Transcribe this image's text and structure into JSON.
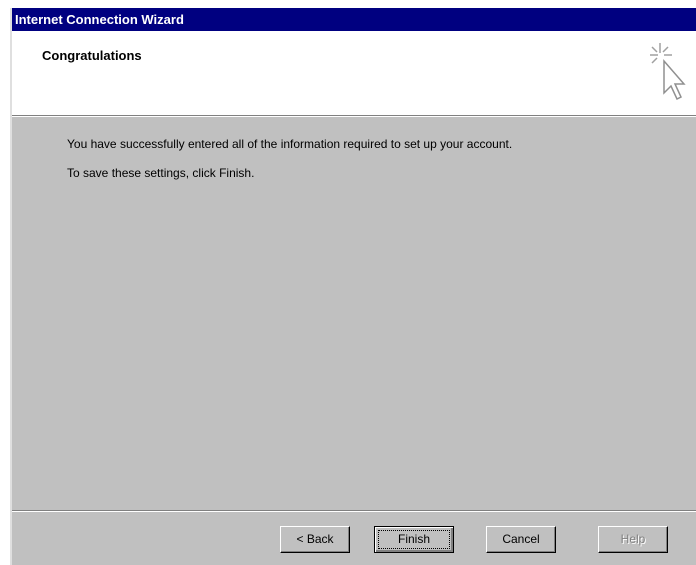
{
  "window": {
    "title": "Internet Connection Wizard"
  },
  "header": {
    "title": "Congratulations",
    "icon": "wizard-cursor-sparkle-icon"
  },
  "content": {
    "message1": "You have successfully entered all of the information required to set up your account.",
    "message2": "To save these settings, click Finish."
  },
  "buttons": {
    "back": "< Back",
    "finish": "Finish",
    "cancel": "Cancel",
    "help": "Help"
  },
  "colors": {
    "titlebar": "#000080",
    "dialog_face": "#c0c0c0",
    "header_bg": "#ffffff"
  }
}
